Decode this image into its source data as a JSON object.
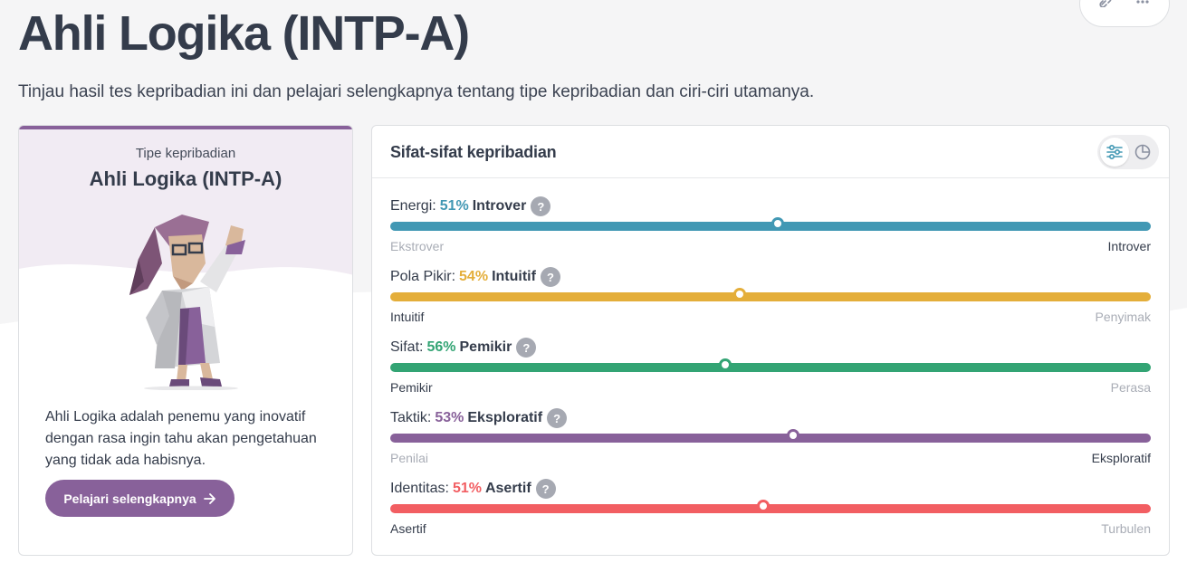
{
  "page": {
    "title": "Ahli Logika (INTP-A)",
    "subtitle": "Tinjau hasil tes kepribadian ini dan pelajari selengkapnya tentang tipe kepribadian dan ciri-ciri utamanya."
  },
  "share_actions": {
    "icons": [
      "link-icon",
      "more-icon"
    ]
  },
  "type_card": {
    "label": "Tipe kepribadian",
    "name": "Ahli Logika (INTP-A)",
    "accent_color": "#88619a",
    "description": "Ahli Logika adalah penemu yang inovatif dengan rasa ingin tahu akan pengetahuan yang tidak ada habisnya.",
    "button_label": "Pelajari selengkapnya",
    "button_icon": "arrow-right-icon"
  },
  "traits_card": {
    "title": "Sifat-sifat kepribadian",
    "view_options": [
      {
        "icon": "sliders-icon",
        "active": true
      },
      {
        "icon": "pie-chart-icon",
        "active": false
      }
    ],
    "help_glyph": "?",
    "traits": [
      {
        "name": "Energi:",
        "percent": "51%",
        "dominant": "Introver",
        "color": "#4298b4",
        "value": 0.51,
        "left_label": "Ekstrover",
        "right_label": "Introver",
        "dominant_side": "right"
      },
      {
        "name": "Pola Pikir:",
        "percent": "54%",
        "dominant": "Intuitif",
        "color": "#e4ae3a",
        "value": 0.54,
        "left_label": "Intuitif",
        "right_label": "Penyimak",
        "dominant_side": "left"
      },
      {
        "name": "Sifat:",
        "percent": "56%",
        "dominant": "Pemikir",
        "color": "#33a474",
        "value": 0.56,
        "left_label": "Pemikir",
        "right_label": "Perasa",
        "dominant_side": "left"
      },
      {
        "name": "Taktik:",
        "percent": "53%",
        "dominant": "Eksploratif",
        "color": "#88619a",
        "value": 0.53,
        "left_label": "Penilai",
        "right_label": "Eksploratif",
        "dominant_side": "right"
      },
      {
        "name": "Identitas:",
        "percent": "51%",
        "dominant": "Asertif",
        "color": "#f25e62",
        "value": 0.51,
        "left_label": "Asertif",
        "right_label": "Turbulen",
        "dominant_side": "left"
      }
    ]
  }
}
